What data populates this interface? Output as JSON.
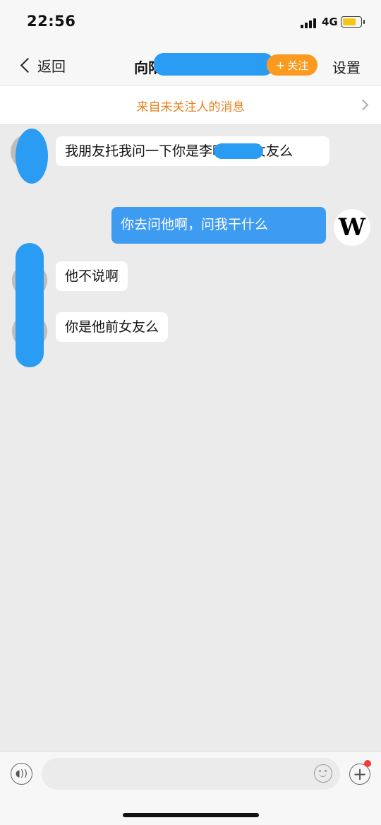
{
  "status_bar": {
    "time": "22:56",
    "network": "4G"
  },
  "nav": {
    "back_label": "返回",
    "title": "向阳",
    "follow_label": "关注",
    "follow_plus": "+",
    "settings_label": "设置"
  },
  "banner": {
    "text": "来自未关注人的消息"
  },
  "messages": [
    {
      "sender": "other",
      "text": "我朋友托我问一下你是李晓的前女友么"
    },
    {
      "sender": "me",
      "text": "你去问他啊，问我干什么"
    },
    {
      "sender": "other",
      "text": "他不说啊"
    },
    {
      "sender": "other",
      "text": "你是他前女友么"
    }
  ],
  "me_avatar_letter": "W",
  "input": {
    "placeholder": ""
  },
  "colors": {
    "accent_blue": "#3d9bf2",
    "follow_orange": "#fb9a1e",
    "banner_text": "#e8801c",
    "badge_red": "#f23b3b"
  },
  "icons": [
    "chevron-left-icon",
    "chevron-right-icon",
    "voice-icon",
    "emoji-icon",
    "plus-icon",
    "signal-icon",
    "battery-icon"
  ]
}
